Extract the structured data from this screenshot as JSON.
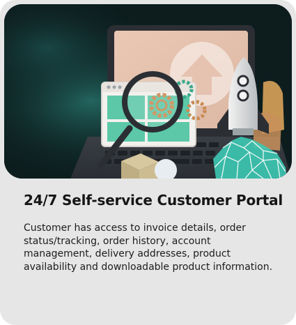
{
  "card": {
    "title": "24/7 Self-service Customer Portal",
    "description": "Customer has access to invoice details, order status/tracking, order history, account management, delivery addresses, product availability and downloadable product information."
  },
  "colors": {
    "card_background": "#e6e6e6",
    "hero_background": "#0d1d1e",
    "accent_teal": "#2fb8a4",
    "title_text": "#161616"
  },
  "icons": [
    "laptop-icon",
    "magnifying-glass-icon",
    "gear-icon",
    "rocket-icon",
    "upload-arrow-icon",
    "package-box-icon"
  ]
}
